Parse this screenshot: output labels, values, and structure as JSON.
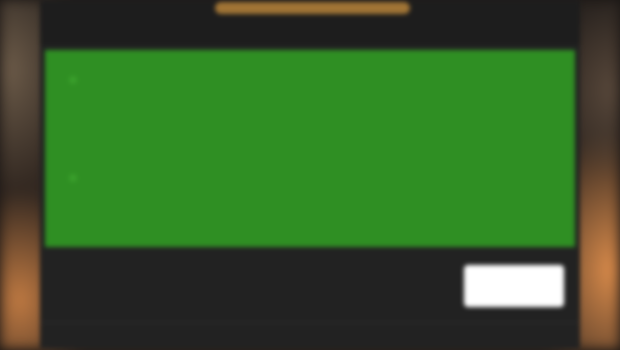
{
  "header": {
    "right_label": ""
  },
  "entries": [
    {
      "title": "",
      "subtitle": "",
      "time": "",
      "main": ""
    },
    {
      "title": "",
      "subtitle": "",
      "time": "",
      "main": ""
    }
  ],
  "total": {
    "label": "",
    "value": ""
  },
  "footer": {
    "left": "",
    "right": ""
  },
  "colors": {
    "panel_green": "#2f8f23",
    "accent_gold": "#d4a13a",
    "dark_surface": "#222222"
  }
}
